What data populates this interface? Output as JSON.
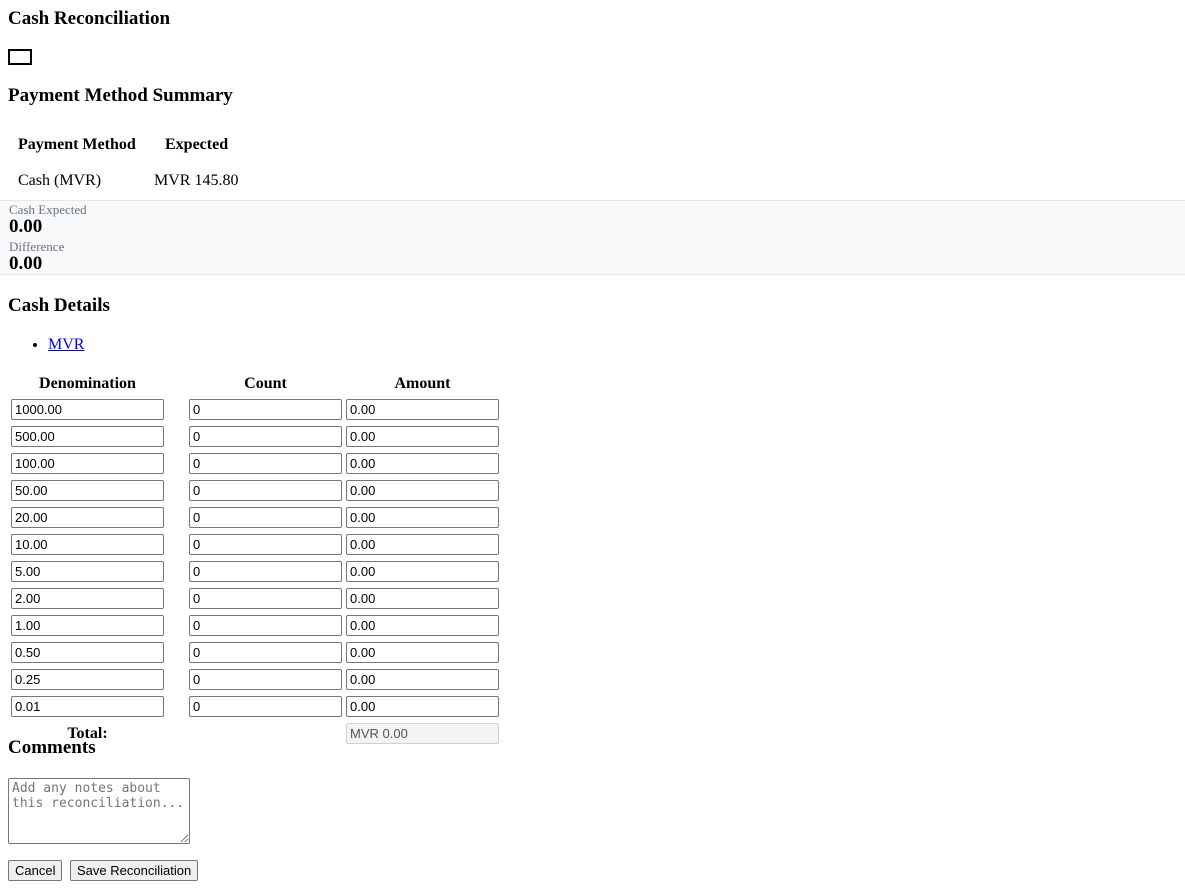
{
  "page": {
    "title": "Cash Reconciliation"
  },
  "summary": {
    "heading": "Payment Method Summary",
    "columns": [
      "Payment Method",
      "Expected"
    ],
    "rows": [
      {
        "method": "Cash (MVR)",
        "expected": "MVR 145.80"
      }
    ]
  },
  "stats": {
    "cash_expected_label": "Cash Expected",
    "cash_expected_value": "0.00",
    "difference_label": "Difference",
    "difference_value": "0.00"
  },
  "cash_details": {
    "heading": "Cash Details",
    "tabs": [
      "MVR"
    ],
    "columns": [
      "Denomination",
      "Count",
      "Amount"
    ],
    "rows": [
      {
        "denomination": "1000.00",
        "count": "0",
        "amount": "0.00"
      },
      {
        "denomination": "500.00",
        "count": "0",
        "amount": "0.00"
      },
      {
        "denomination": "100.00",
        "count": "0",
        "amount": "0.00"
      },
      {
        "denomination": "50.00",
        "count": "0",
        "amount": "0.00"
      },
      {
        "denomination": "20.00",
        "count": "0",
        "amount": "0.00"
      },
      {
        "denomination": "10.00",
        "count": "0",
        "amount": "0.00"
      },
      {
        "denomination": "5.00",
        "count": "0",
        "amount": "0.00"
      },
      {
        "denomination": "2.00",
        "count": "0",
        "amount": "0.00"
      },
      {
        "denomination": "1.00",
        "count": "0",
        "amount": "0.00"
      },
      {
        "denomination": "0.50",
        "count": "0",
        "amount": "0.00"
      },
      {
        "denomination": "0.25",
        "count": "0",
        "amount": "0.00"
      },
      {
        "denomination": "0.01",
        "count": "0",
        "amount": "0.00"
      }
    ],
    "total_label": "Total:",
    "total_value": "MVR 0.00"
  },
  "comments": {
    "heading": "Comments",
    "placeholder": "Add any notes about this reconciliation..."
  },
  "actions": {
    "cancel_label": "Cancel",
    "save_label": "Save Reconciliation"
  }
}
